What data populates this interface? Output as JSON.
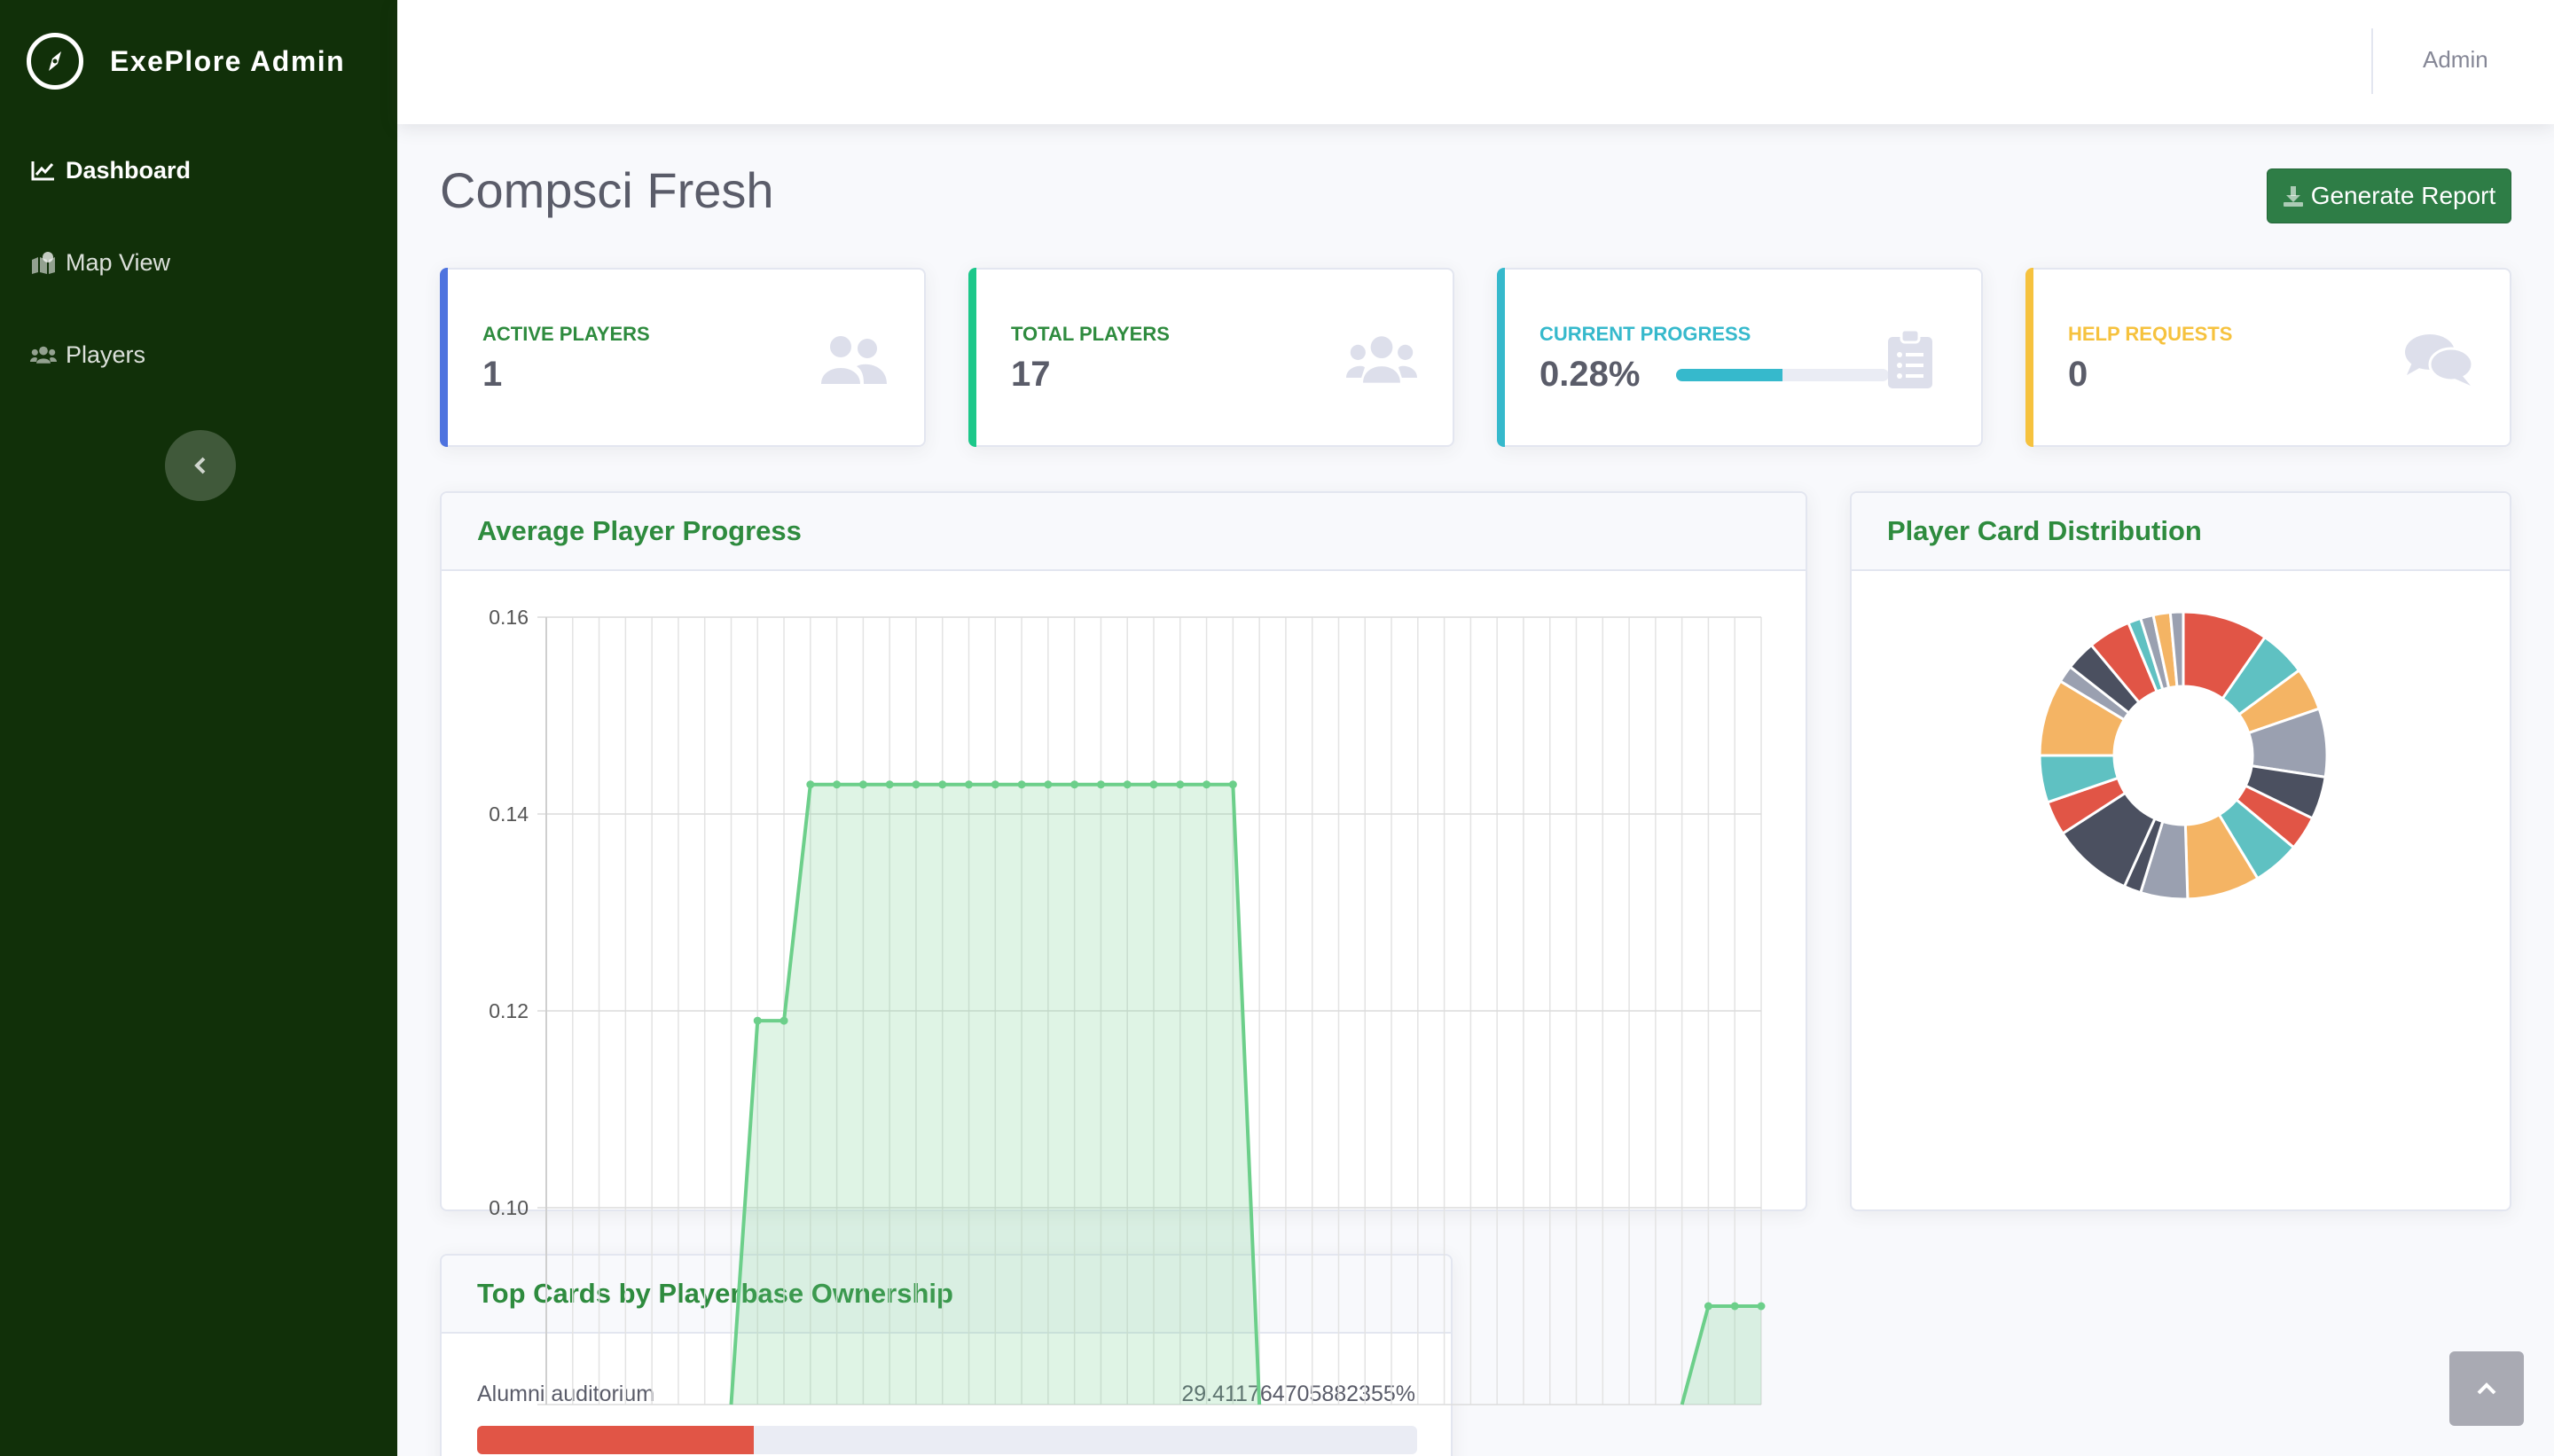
{
  "brand": {
    "name": "ExePlore Admin",
    "icon": "compass-icon"
  },
  "sidebar": {
    "items": [
      {
        "label": "Dashboard",
        "icon": "chart-line-icon",
        "active": true
      },
      {
        "label": "Map View",
        "icon": "map-marked-icon",
        "active": false
      },
      {
        "label": "Players",
        "icon": "users-icon",
        "active": false
      }
    ],
    "toggle_icon": "chevron-left-icon"
  },
  "topbar": {
    "user": "Admin"
  },
  "page": {
    "title": "Compsci Fresh",
    "generate_report_label": "Generate Report",
    "generate_report_icon": "download-icon"
  },
  "stats": {
    "active_players": {
      "label": "Active Players",
      "value": "1",
      "color": "#4e73df",
      "icon": "user-friends-icon"
    },
    "total_players": {
      "label": "Total Players",
      "value": "17",
      "color": "#1cc88a",
      "icon": "users-icon"
    },
    "current_progress": {
      "label": "Current Progress",
      "value": "0.28%",
      "color": "#36b9cc",
      "icon": "clipboard-list-icon",
      "bar_fraction": 0.5
    },
    "help_requests": {
      "label": "Help Requests",
      "value": "0",
      "color": "#f6c23e",
      "icon": "comments-icon"
    }
  },
  "panels": {
    "avg_progress_title": "Average Player Progress",
    "distribution_title": "Player Card Distribution",
    "top_cards_title": "Top Cards by Playerbase Ownership"
  },
  "top_cards": [
    {
      "name": "Alumni auditorium",
      "value": "29.411764705882355%",
      "fraction": 0.294
    }
  ],
  "chart_data": [
    {
      "type": "area",
      "title": "Average Player Progress",
      "ylim": [
        0.08,
        0.16
      ],
      "yticks": [
        "0.16",
        "0.14",
        "0.12",
        "0.10"
      ],
      "grid": true,
      "color": "#6ccf8a",
      "series": [
        {
          "values": [
            null,
            null,
            null,
            null,
            null,
            null,
            null,
            0.08,
            0.119,
            0.119,
            0.143,
            0.143,
            0.143,
            0.143,
            0.143,
            0.143,
            0.143,
            0.143,
            0.143,
            0.143,
            0.143,
            0.143,
            0.143,
            0.143,
            0.143,
            0.143,
            0.143,
            0.08,
            null,
            null,
            null,
            null,
            null,
            null,
            null,
            null,
            null,
            null,
            null,
            null,
            null,
            null,
            null,
            0.08,
            0.09,
            0.09,
            0.09
          ]
        }
      ]
    },
    {
      "type": "pie",
      "title": "Player Card Distribution",
      "values": [
        10,
        5.5,
        5,
        8,
        5,
        4,
        5.5,
        8.5,
        5.5,
        2,
        9.5,
        4,
        5.5,
        9,
        2,
        3.5,
        5,
        1.5,
        1.5,
        2,
        1.5
      ],
      "colors": [
        "#e15546",
        "#5fc1c2",
        "#f4b464",
        "#9aa0b0",
        "#4b5060",
        "#e15546",
        "#5fc1c2",
        "#f4b464",
        "#9aa0b0",
        "#4b5060",
        "#4b5060",
        "#e15546",
        "#5fc1c2",
        "#f4b464",
        "#9aa0b0",
        "#4b5060",
        "#e15546",
        "#5fc1c2",
        "#9aa0b0",
        "#f4b464",
        "#9aa0b0"
      ]
    }
  ]
}
